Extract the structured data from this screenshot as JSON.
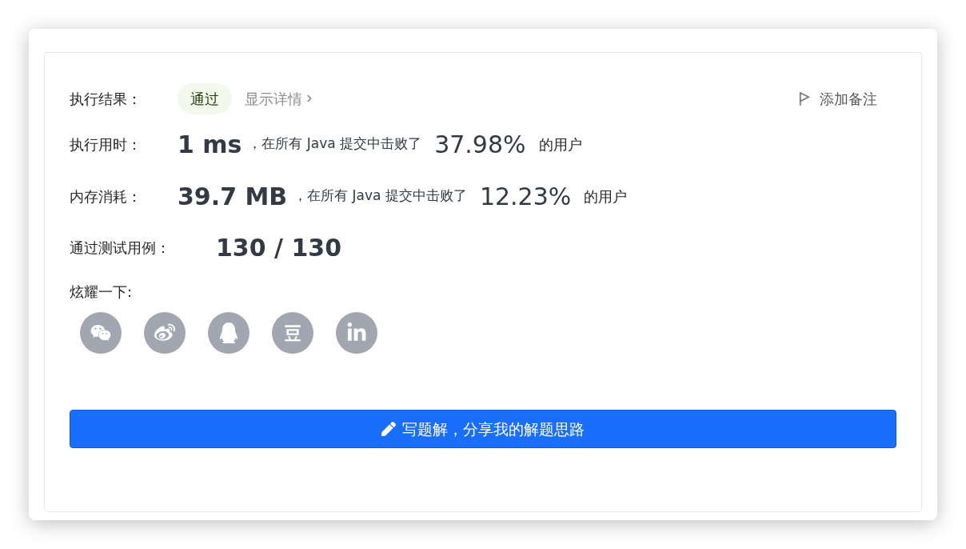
{
  "result": {
    "label": "执行结果：",
    "status": "通过",
    "details_link": "显示详情",
    "note_button": "添加备注"
  },
  "stats": [
    {
      "label": "执行用时：",
      "value": "1 ms",
      "text": "，在所有 Java 提交中击败了",
      "percent": "37.98%",
      "suffix": "的用户"
    },
    {
      "label": "内存消耗：",
      "value": "39.7 MB",
      "text": "，在所有 Java 提交中击败了",
      "percent": "12.23%",
      "suffix": "的用户"
    }
  ],
  "test_cases": {
    "label": "通过测试用例：",
    "passed": "130",
    "separator": "/",
    "total": "130"
  },
  "share": {
    "label": "炫耀一下:"
  },
  "write_button": "写题解，分享我的解题思路"
}
